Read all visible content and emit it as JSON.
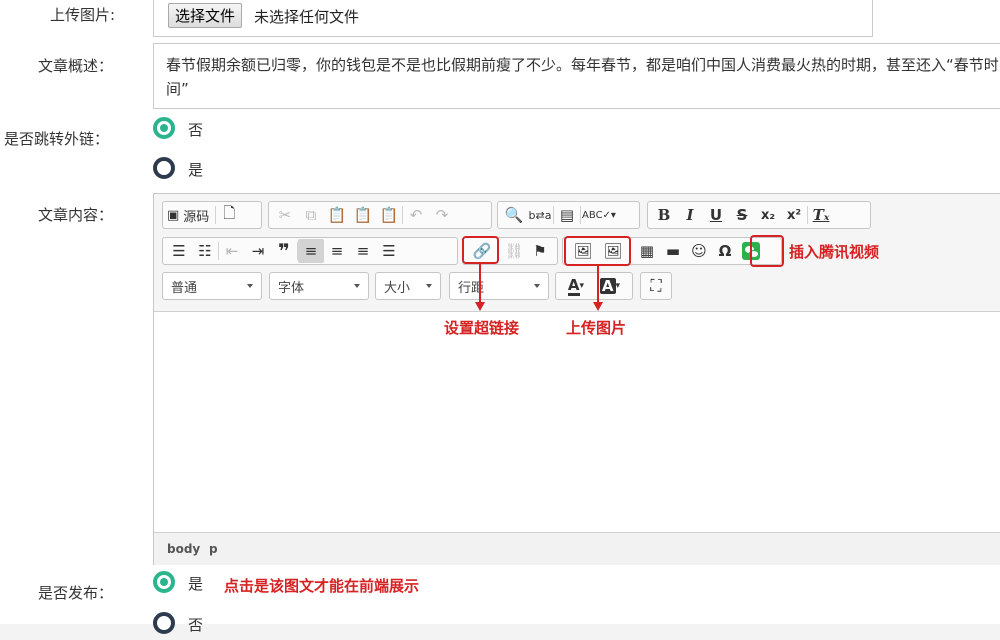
{
  "form": {
    "upload_label": "上传图片:",
    "file_button": "选择文件",
    "file_status": "未选择任何文件",
    "summary_label": "文章概述：",
    "summary_text": "春节假期余额已归零，你的钱包是不是也比假期前瘦了不少。每年春节，都是咱们中国人消费最火热的时期，甚至还入“春节时间”",
    "redirect_label": "是否跳转外链：",
    "redirect_options": [
      "否",
      "是"
    ],
    "content_label": "文章内容：",
    "publish_label": "是否发布：",
    "publish_options": [
      "是",
      "否"
    ]
  },
  "toolbar": {
    "source": "源码",
    "combos": [
      "普通",
      "字体",
      "大小",
      "行距"
    ]
  },
  "statusbar": {
    "path": [
      "body",
      "p"
    ]
  },
  "annotations": {
    "video": "插入腾讯视频",
    "link": "设置超链接",
    "image": "上传图片",
    "publish": "点击是该图文才能在前端展示"
  },
  "colors": {
    "accent": "#2bb58f",
    "annotation": "#d62222",
    "radio_off": "#2e3b4e"
  }
}
